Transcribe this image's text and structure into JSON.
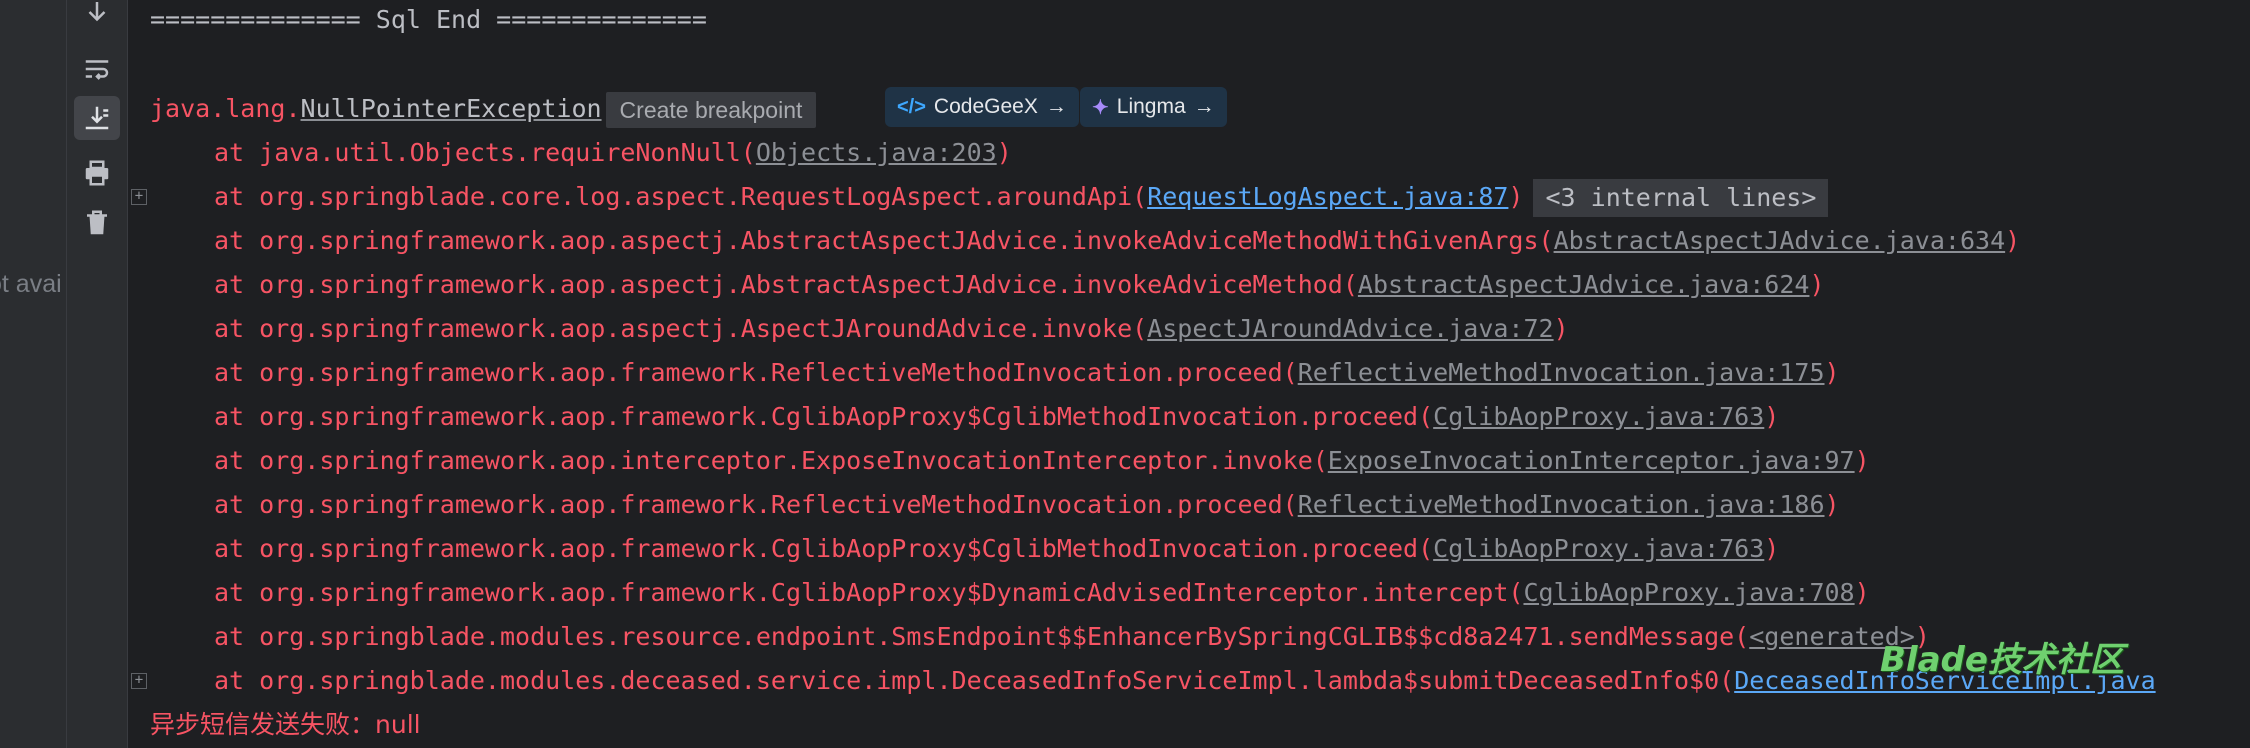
{
  "left_panel": {
    "clipped_text": "ot avai"
  },
  "toolbar": {
    "icons": [
      "arrow-down-icon",
      "soft-wrap-icon",
      "scroll-to-end-icon",
      "print-icon",
      "trash-icon"
    ]
  },
  "console": {
    "separator": "==============  Sql  End   ==============",
    "exception": {
      "prefix": "java.lang.",
      "class_link": "NullPointerException",
      "create_breakpoint": "Create breakpoint",
      "codegeex": "CodeGeeX",
      "lingma": "Lingma"
    },
    "stack": [
      {
        "pre": "at java.util.Objects.requireNonNull(",
        "link": "Objects.java:203",
        "post": ")"
      },
      {
        "pre": "at org.springblade.core.log.aspect.RequestLogAspect.aroundApi(",
        "link": "RequestLogAspect.java:87",
        "post": ")",
        "internal": "<3 internal lines>"
      },
      {
        "pre": "at org.springframework.aop.aspectj.AbstractAspectJAdvice.invokeAdviceMethodWithGivenArgs(",
        "link": "AbstractAspectJAdvice.java:634",
        "post": ")"
      },
      {
        "pre": "at org.springframework.aop.aspectj.AbstractAspectJAdvice.invokeAdviceMethod(",
        "link": "AbstractAspectJAdvice.java:624",
        "post": ")"
      },
      {
        "pre": "at org.springframework.aop.aspectj.AspectJAroundAdvice.invoke(",
        "link": "AspectJAroundAdvice.java:72",
        "post": ")"
      },
      {
        "pre": "at org.springframework.aop.framework.ReflectiveMethodInvocation.proceed(",
        "link": "ReflectiveMethodInvocation.java:175",
        "post": ")"
      },
      {
        "pre": "at org.springframework.aop.framework.CglibAopProxy$CglibMethodInvocation.proceed(",
        "link": "CglibAopProxy.java:763",
        "post": ")"
      },
      {
        "pre": "at org.springframework.aop.interceptor.ExposeInvocationInterceptor.invoke(",
        "link": "ExposeInvocationInterceptor.java:97",
        "post": ")"
      },
      {
        "pre": "at org.springframework.aop.framework.ReflectiveMethodInvocation.proceed(",
        "link": "ReflectiveMethodInvocation.java:186",
        "post": ")"
      },
      {
        "pre": "at org.springframework.aop.framework.CglibAopProxy$CglibMethodInvocation.proceed(",
        "link": "CglibAopProxy.java:763",
        "post": ")"
      },
      {
        "pre": "at org.springframework.aop.framework.CglibAopProxy$DynamicAdvisedInterceptor.intercept(",
        "link": "CglibAopProxy.java:708",
        "post": ")"
      },
      {
        "pre": "at org.springblade.modules.resource.endpoint.SmsEndpoint$$EnhancerBySpringCGLIB$$cd8a2471.sendMessage(",
        "link": "<generated>",
        "post": ")"
      },
      {
        "pre": "at org.springblade.modules.deceased.service.impl.DeceasedInfoServiceImpl.lambda$submitDeceasedInfo$0(",
        "link": "DeceasedInfoServiceImpl.java",
        "post": ""
      }
    ],
    "final_message": "异步短信发送失败：null"
  },
  "watermark": "Blade技术社区",
  "colors": {
    "background": "#1e1f22",
    "error_text": "#f75464",
    "link_gray": "#8c8f95",
    "link_blue": "#5ba8f7",
    "watermark_green": "#6fd06f"
  }
}
